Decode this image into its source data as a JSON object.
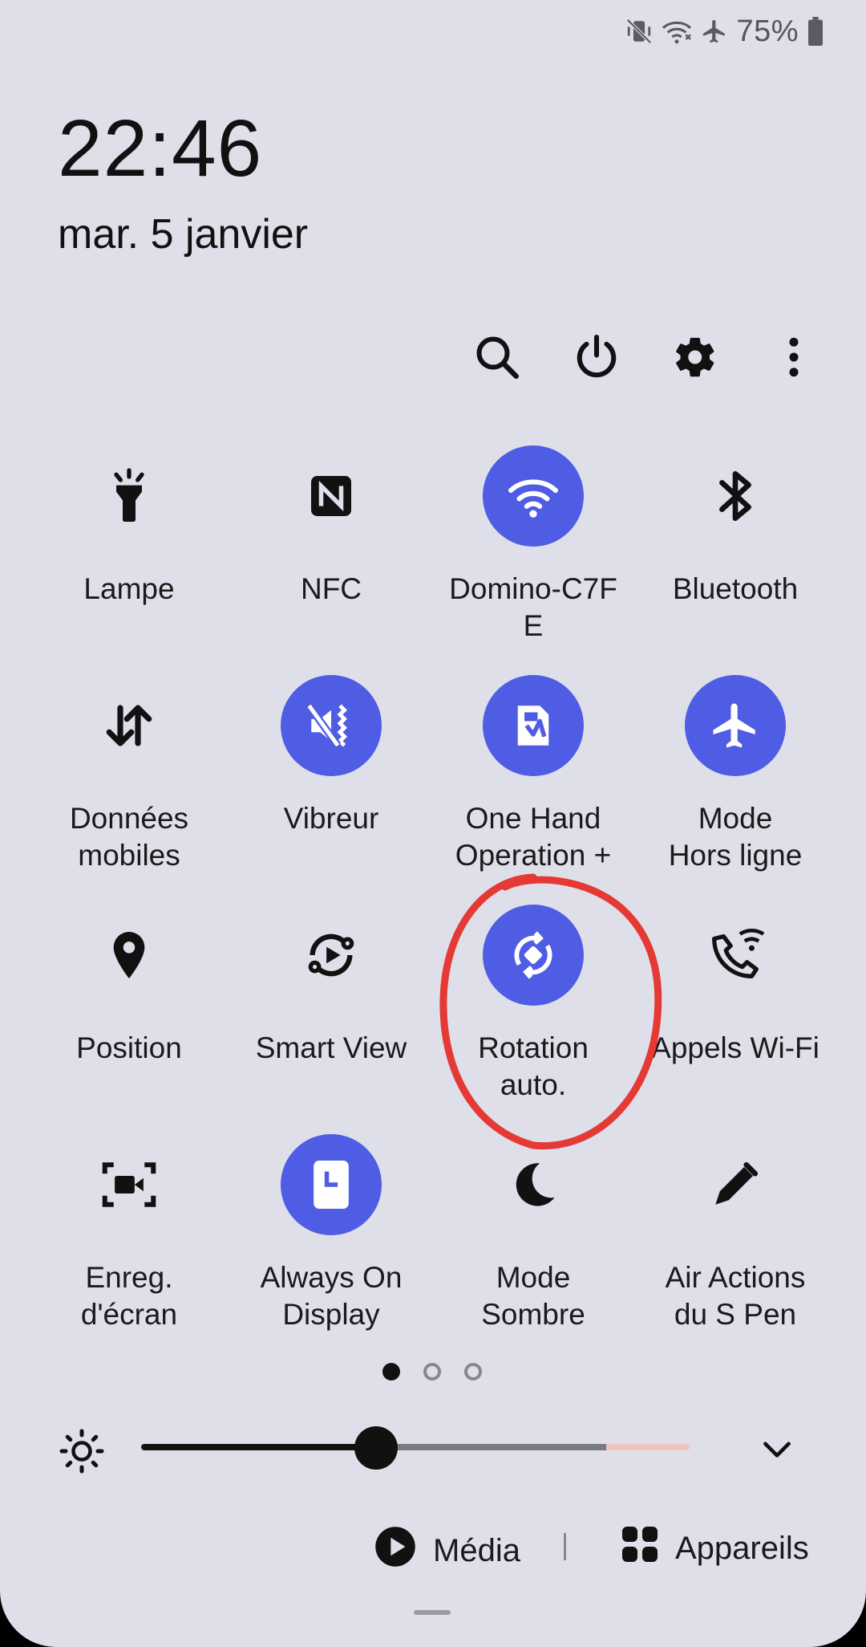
{
  "status_bar": {
    "icons": [
      "vibrate-mute-icon",
      "wifi-calling-icon",
      "airplane-icon",
      "battery-icon"
    ],
    "battery_percent": "75%"
  },
  "clock": {
    "time": "22:46",
    "date": "mar. 5 janvier"
  },
  "top_actions": [
    "search-icon",
    "power-icon",
    "gear-icon",
    "more-vert-icon"
  ],
  "tiles": [
    {
      "label": "Lampe",
      "icon": "flashlight-icon",
      "active": false
    },
    {
      "label": "NFC",
      "icon": "nfc-icon",
      "active": false
    },
    {
      "label": "Domino-C7F\nE",
      "icon": "wifi-icon",
      "active": true
    },
    {
      "label": "Bluetooth",
      "icon": "bluetooth-icon",
      "active": false
    },
    {
      "label": "Données\nmobiles",
      "icon": "mobile-data-icon",
      "active": false
    },
    {
      "label": "Vibreur",
      "icon": "vibrate-icon",
      "active": true
    },
    {
      "label": "One Hand\nOperation +",
      "icon": "one-hand-icon",
      "active": true
    },
    {
      "label": "Mode\nHors ligne",
      "icon": "airplane-icon",
      "active": true
    },
    {
      "label": "Position",
      "icon": "location-icon",
      "active": false
    },
    {
      "label": "Smart View",
      "icon": "smart-view-icon",
      "active": false
    },
    {
      "label": "Rotation\nauto.",
      "icon": "auto-rotate-icon",
      "active": true
    },
    {
      "label": "Appels Wi-Fi",
      "icon": "wifi-call-icon",
      "active": false
    },
    {
      "label": "Enreg.\nd'écran",
      "icon": "screen-record-icon",
      "active": false
    },
    {
      "label": "Always On\nDisplay",
      "icon": "always-on-display-icon",
      "active": true
    },
    {
      "label": "Mode\nSombre",
      "icon": "moon-icon",
      "active": false
    },
    {
      "label": "Air Actions\ndu S Pen",
      "icon": "pen-icon",
      "active": false
    }
  ],
  "pages": {
    "count": 3,
    "current": 1
  },
  "brightness": {
    "level_fraction": 0.4
  },
  "bottom": {
    "media_label": "Média",
    "devices_label": "Appareils"
  },
  "colors": {
    "accent": "#4f5de4",
    "panel_bg": "#dfdfea",
    "annotation": "#e53935"
  }
}
